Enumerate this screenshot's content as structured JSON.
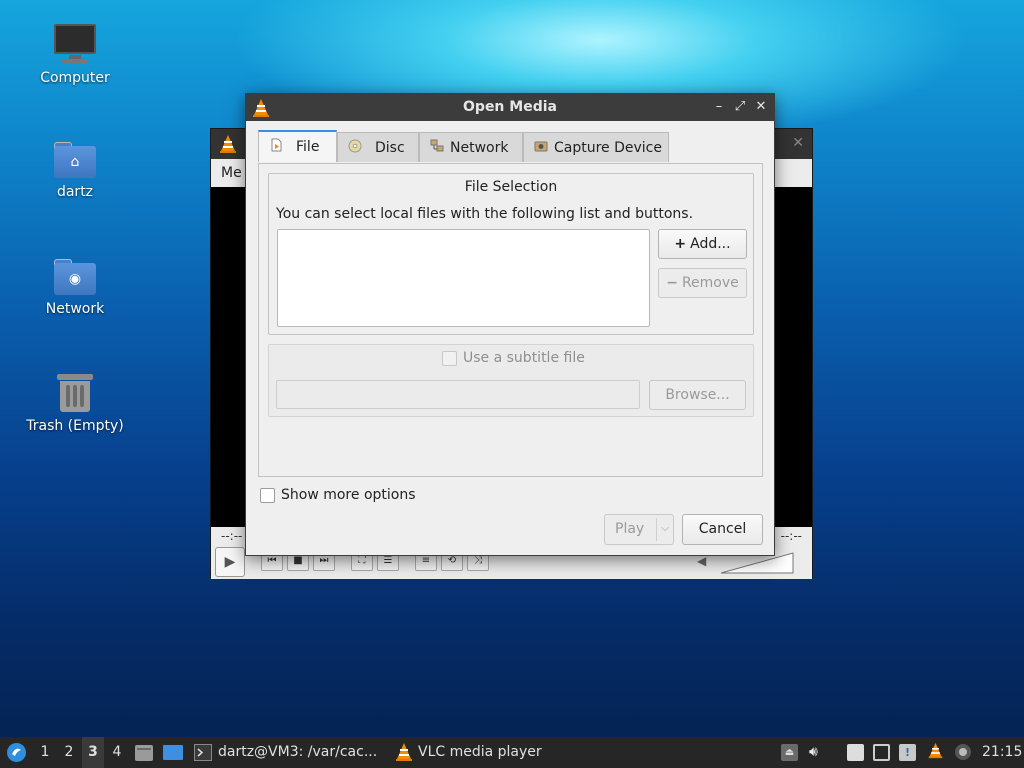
{
  "desktop": {
    "icons": [
      {
        "label": "Computer",
        "icon": "monitor-icon"
      },
      {
        "label": "dartz",
        "icon": "home-folder-icon"
      },
      {
        "label": "Network",
        "icon": "network-folder-icon"
      },
      {
        "label": "Trash (Empty)",
        "icon": "trash-icon"
      }
    ]
  },
  "vlc_window": {
    "menu_partial": "Me",
    "time_left": "--:--",
    "time_right": "--:--",
    "volume": "0%"
  },
  "dialog": {
    "title": "Open Media",
    "title_buttons": [
      "minimize",
      "maximize",
      "close"
    ],
    "tabs": [
      {
        "label": "File",
        "icon": "file-icon",
        "active": true
      },
      {
        "label": "Disc",
        "icon": "disc-icon",
        "active": false
      },
      {
        "label": "Network",
        "icon": "network-icon",
        "active": false
      },
      {
        "label": "Capture Device",
        "icon": "capture-device-icon",
        "active": false
      }
    ],
    "file_selection": {
      "title": "File Selection",
      "description": "You can select local files with the following list and buttons.",
      "add_label": "Add...",
      "remove_label": "Remove"
    },
    "subtitle": {
      "checkbox_label": "Use a subtitle file",
      "checked": false,
      "browse_label": "Browse..."
    },
    "show_more_label": "Show more options",
    "show_more_checked": false,
    "play_label": "Play",
    "cancel_label": "Cancel"
  },
  "taskbar": {
    "workspaces": [
      "1",
      "2",
      "3",
      "4"
    ],
    "active_workspace": "3",
    "terminal_task": "dartz@VM3: /var/cac...",
    "vlc_task": "VLC media player",
    "clock": "21:15"
  },
  "colors": {
    "accent": "#3a8ee6",
    "vlc_orange": "#f28c00",
    "taskbar_bg": "#262626",
    "dialog_bg": "#efefef"
  }
}
